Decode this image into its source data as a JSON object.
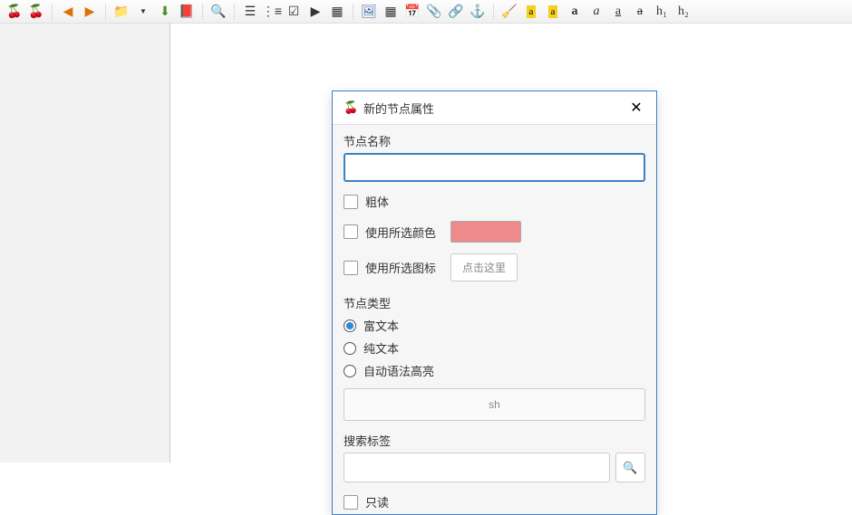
{
  "toolbar": {
    "icons": [
      "cherry",
      "cherry",
      "sep",
      "back",
      "forward",
      "sep",
      "folder",
      "sep",
      "import",
      "pdf",
      "sep",
      "zoom",
      "sep",
      "bullet",
      "numbered",
      "todo",
      "codebox",
      "table2",
      "sep",
      "image",
      "table",
      "date",
      "attach",
      "link",
      "anchor",
      "sep",
      "remove-fmt",
      "fg-color",
      "bg-color",
      "bold",
      "italic",
      "underline",
      "strike",
      "h1",
      "h2"
    ]
  },
  "dialog": {
    "title": "新的节点属性",
    "nodeNameLabel": "节点名称",
    "nodeNameValue": "",
    "boldLabel": "粗体",
    "useColorLabel": "使用所选颜色",
    "colorValue": "#ee8a8a",
    "useIconLabel": "使用所选图标",
    "chooseIconBtn": "点击这里",
    "nodeTypeLabel": "节点类型",
    "typeRich": "富文本",
    "typePlain": "纯文本",
    "typeAuto": "自动语法高亮",
    "selectedType": "rich",
    "langValue": "sh",
    "searchTagsLabel": "搜索标签",
    "searchTagsValue": "",
    "readonlyLabel": "只读"
  }
}
